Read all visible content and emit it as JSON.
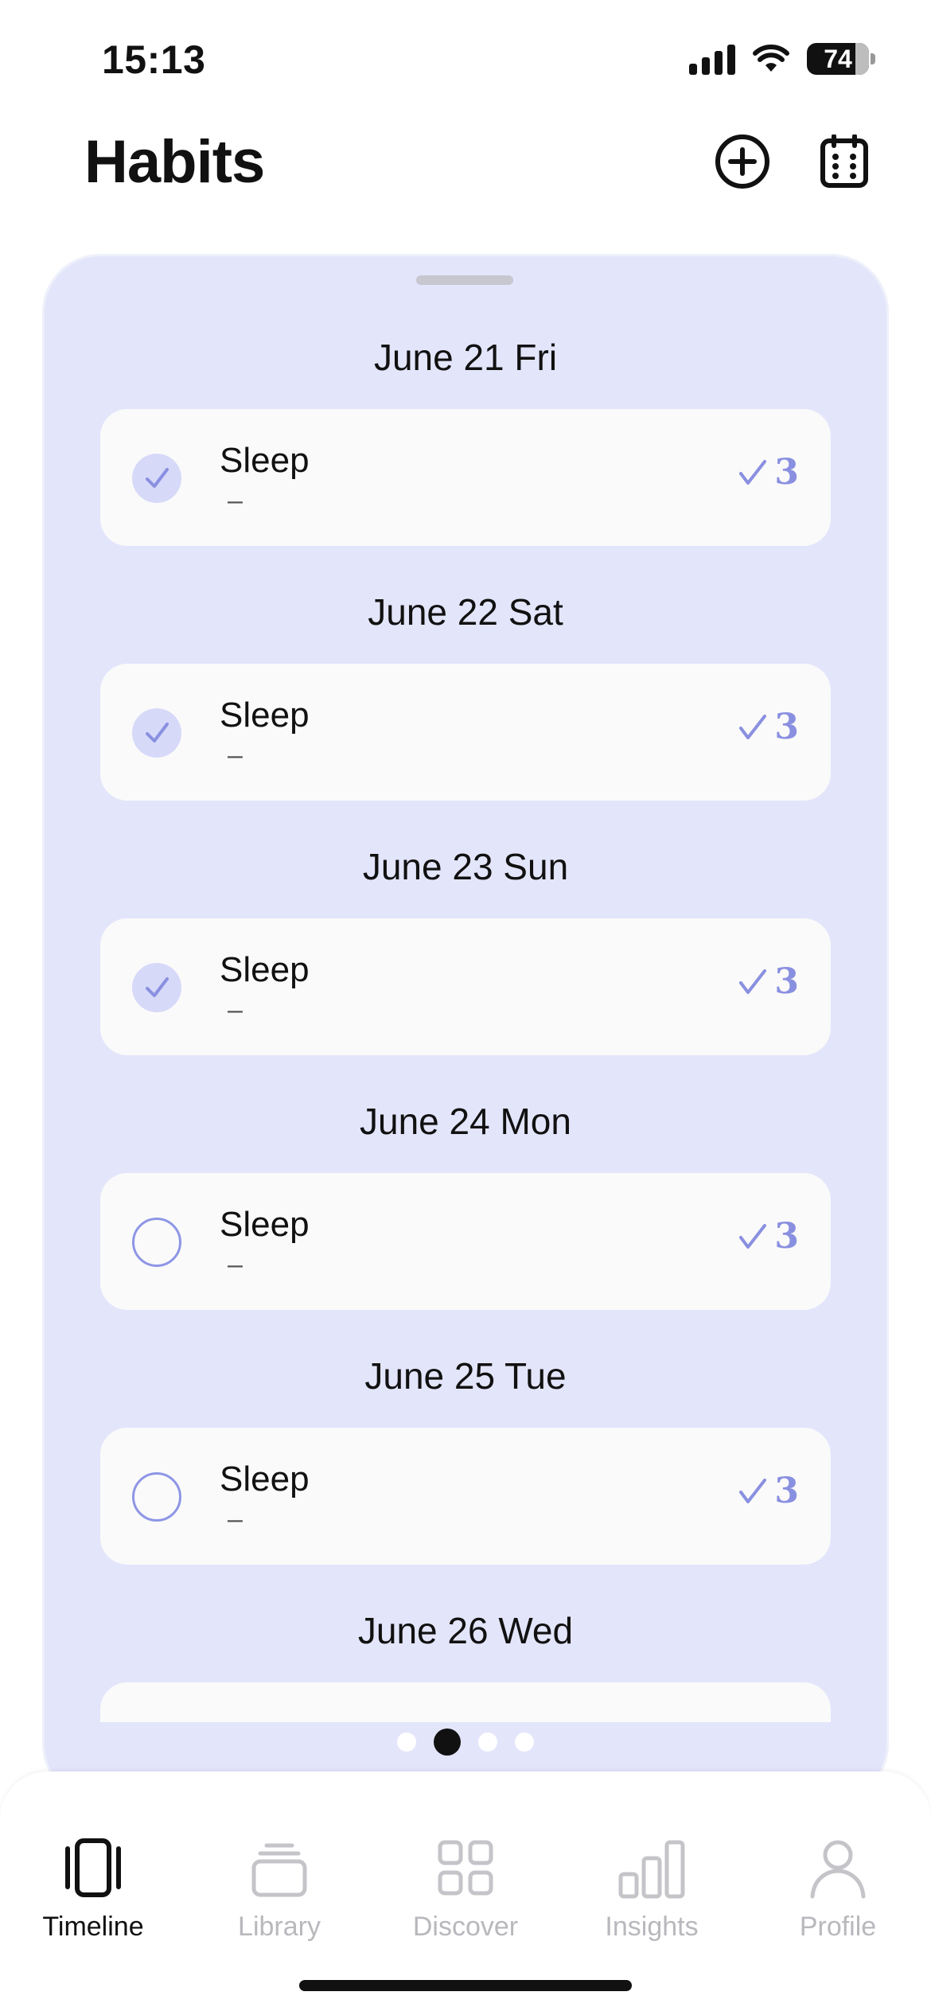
{
  "status_bar": {
    "time": "15:13",
    "battery": "74"
  },
  "header": {
    "title": "Habits"
  },
  "timeline": {
    "days": [
      {
        "date": "June 21 Fri",
        "habit": {
          "name": "Sleep",
          "sub": "–",
          "done": true,
          "streak": "3"
        }
      },
      {
        "date": "June 22 Sat",
        "habit": {
          "name": "Sleep",
          "sub": "–",
          "done": true,
          "streak": "3"
        }
      },
      {
        "date": "June 23 Sun",
        "habit": {
          "name": "Sleep",
          "sub": "–",
          "done": true,
          "streak": "3"
        }
      },
      {
        "date": "June 24 Mon",
        "habit": {
          "name": "Sleep",
          "sub": "–",
          "done": false,
          "streak": "3"
        }
      },
      {
        "date": "June 25 Tue",
        "habit": {
          "name": "Sleep",
          "sub": "–",
          "done": false,
          "streak": "3"
        }
      },
      {
        "date": "June 26 Wed",
        "habit": null
      }
    ],
    "page_count": 4,
    "active_page": 2
  },
  "tabs": [
    {
      "label": "Timeline",
      "icon": "timeline-icon",
      "active": true
    },
    {
      "label": "Library",
      "icon": "library-icon",
      "active": false
    },
    {
      "label": "Discover",
      "icon": "discover-icon",
      "active": false
    },
    {
      "label": "Insights",
      "icon": "insights-icon",
      "active": false
    },
    {
      "label": "Profile",
      "icon": "profile-icon",
      "active": false
    }
  ],
  "colors": {
    "accent": "#8a90e0",
    "panel": "#e3e5fb",
    "card": "#fafafa"
  }
}
